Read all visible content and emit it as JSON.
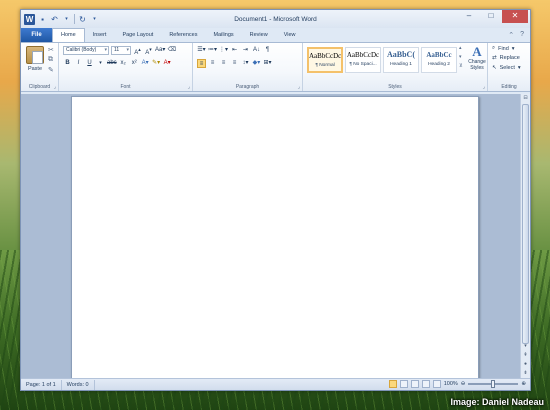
{
  "window": {
    "title": "Document1 - Microsoft Word"
  },
  "credit": "Image: Daniel Nadeau",
  "tabs": {
    "file": "File",
    "items": [
      "Home",
      "Insert",
      "Page Layout",
      "References",
      "Mailings",
      "Review",
      "View"
    ],
    "active": "Home"
  },
  "ribbon": {
    "clipboard": {
      "label": "Clipboard",
      "paste": "Paste"
    },
    "font": {
      "label": "Font",
      "name": "Calibri (Body)",
      "size": "11"
    },
    "paragraph": {
      "label": "Paragraph"
    },
    "styles": {
      "label": "Styles",
      "items": [
        {
          "sample": "AaBbCcDc",
          "name": "¶ Normal"
        },
        {
          "sample": "AaBbCcDc",
          "name": "¶ No Spaci..."
        },
        {
          "sample": "AaBbC(",
          "name": "Heading 1"
        },
        {
          "sample": "AaBbCc",
          "name": "Heading 2"
        }
      ],
      "change": "Change Styles"
    },
    "editing": {
      "label": "Editing",
      "find": "Find",
      "replace": "Replace",
      "select": "Select"
    }
  },
  "status": {
    "page": "Page: 1 of 1",
    "words": "Words: 0",
    "zoom": "100%"
  },
  "colors": {
    "file_tab": "#2b579a",
    "window_bg": "#dfe9f5",
    "workspace": "#abbcd4"
  }
}
